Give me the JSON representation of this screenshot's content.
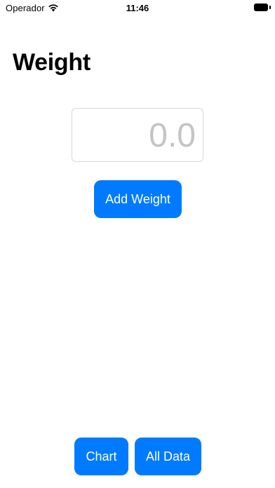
{
  "status_bar": {
    "carrier": "Operador",
    "time": "11:46",
    "wifi_icon": "wifi-icon",
    "battery_icon": "battery-icon"
  },
  "title": "Weight",
  "weight_input": {
    "value": "",
    "placeholder": "0.0"
  },
  "buttons": {
    "add_weight": "Add Weight",
    "chart": "Chart",
    "all_data": "All Data"
  },
  "colors": {
    "accent": "#007aff",
    "placeholder": "#c4c4c6"
  }
}
